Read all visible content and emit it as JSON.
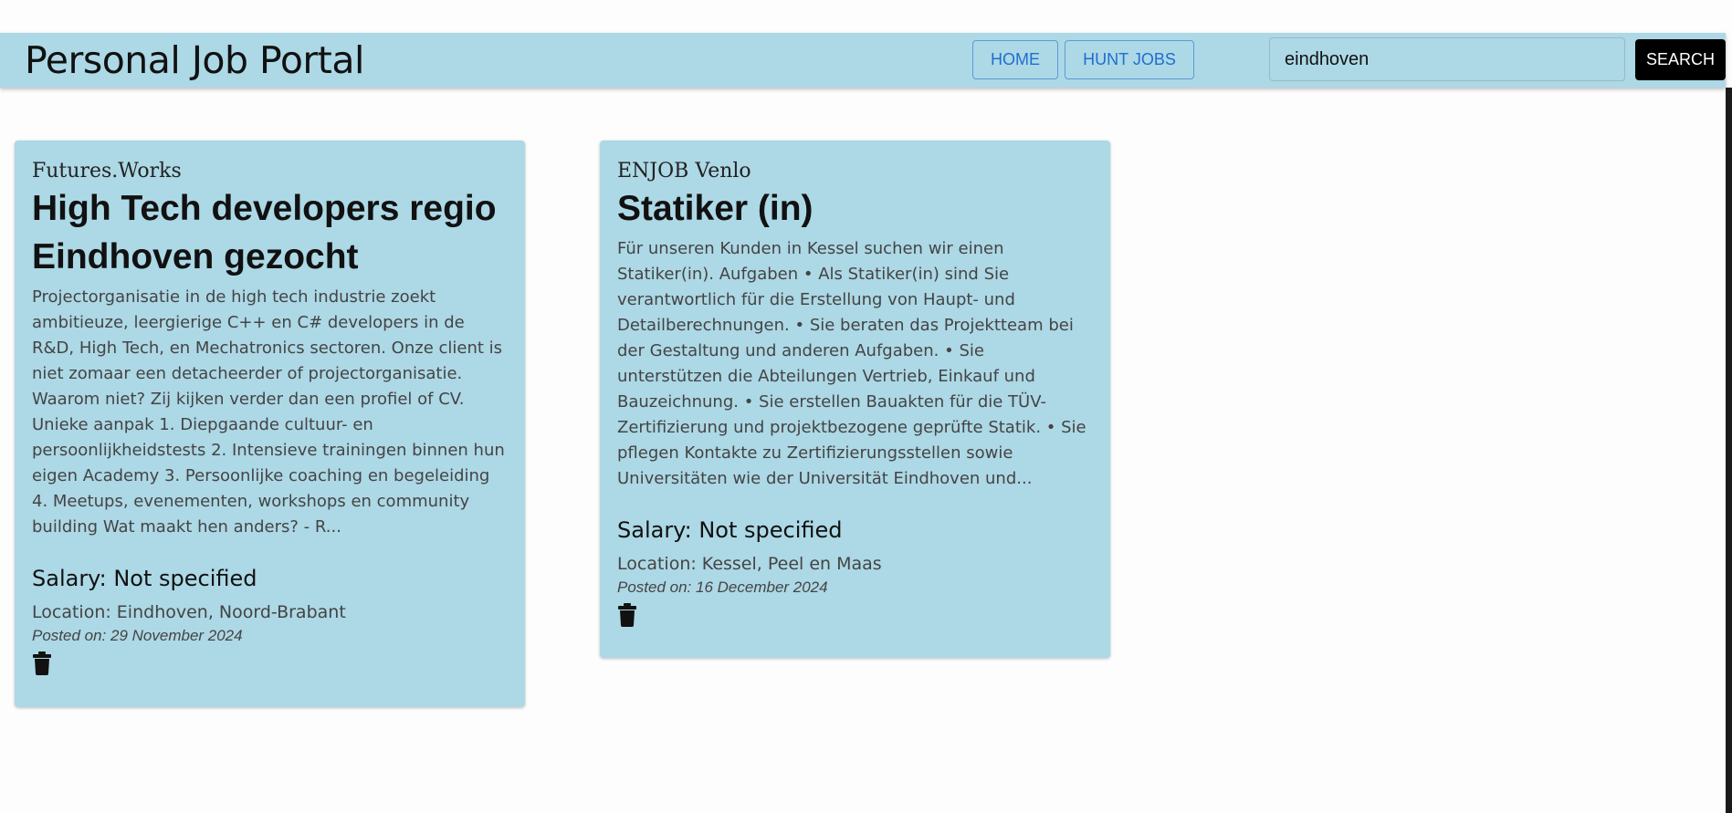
{
  "header": {
    "title": "Personal Job Portal",
    "nav": [
      "HOME",
      "HUNT JOBS"
    ],
    "search_value": "eindhoven",
    "search_button": "SEARCH"
  },
  "jobs": [
    {
      "company": "Futures.Works",
      "title": "High Tech developers regio Eindhoven gezocht",
      "description": "Projectorganisatie in de high tech industrie zoekt ambitieuze, leergierige C++ en C# developers in de R&D, High Tech, en Mechatronics sectoren. Onze client is niet zomaar een detacheerder of projectorganisatie. Waarom niet? Zij kijken verder dan een profiel of CV. Unieke aanpak 1. Diepgaande cultuur- en persoonlijkheidstests 2. Intensieve trainingen binnen hun eigen Academy 3. Persoonlijke coaching en begeleiding 4. Meetups, evenementen, workshops en community building Wat maakt hen anders? - R...",
      "salary": "Salary: Not specified",
      "location": "Location: Eindhoven, Noord-Brabant",
      "posted": "Posted on: 29 November 2024",
      "delete_icon": "trash-icon"
    },
    {
      "company": "ENJOB Venlo",
      "title": "Statiker (in)",
      "description": "Für unseren Kunden in Kessel suchen wir einen Statiker(in). Aufgaben • Als Statiker(in) sind Sie verantwortlich für die Erstellung von Haupt- und Detailberechnungen. • Sie beraten das Projektteam bei der Gestaltung und anderen Aufgaben. • Sie unterstützen die Abteilungen Vertrieb, Einkauf und Bauzeichnung. • Sie erstellen Bauakten für die TÜV-Zertifizierung und projektbezogene geprüfte Statik. • Sie pflegen Kontakte zu Zertifizierungsstellen sowie Universitäten wie der Universität Eindhoven und...",
      "salary": "Salary: Not specified",
      "location": "Location: Kessel, Peel en Maas",
      "posted": "Posted on: 16 December 2024",
      "delete_icon": "trash-icon"
    }
  ],
  "colors": {
    "header_bg": "#add8e6",
    "card_bg": "#add8e6",
    "nav_text": "#1f6fce",
    "search_button_bg": "#000000"
  }
}
